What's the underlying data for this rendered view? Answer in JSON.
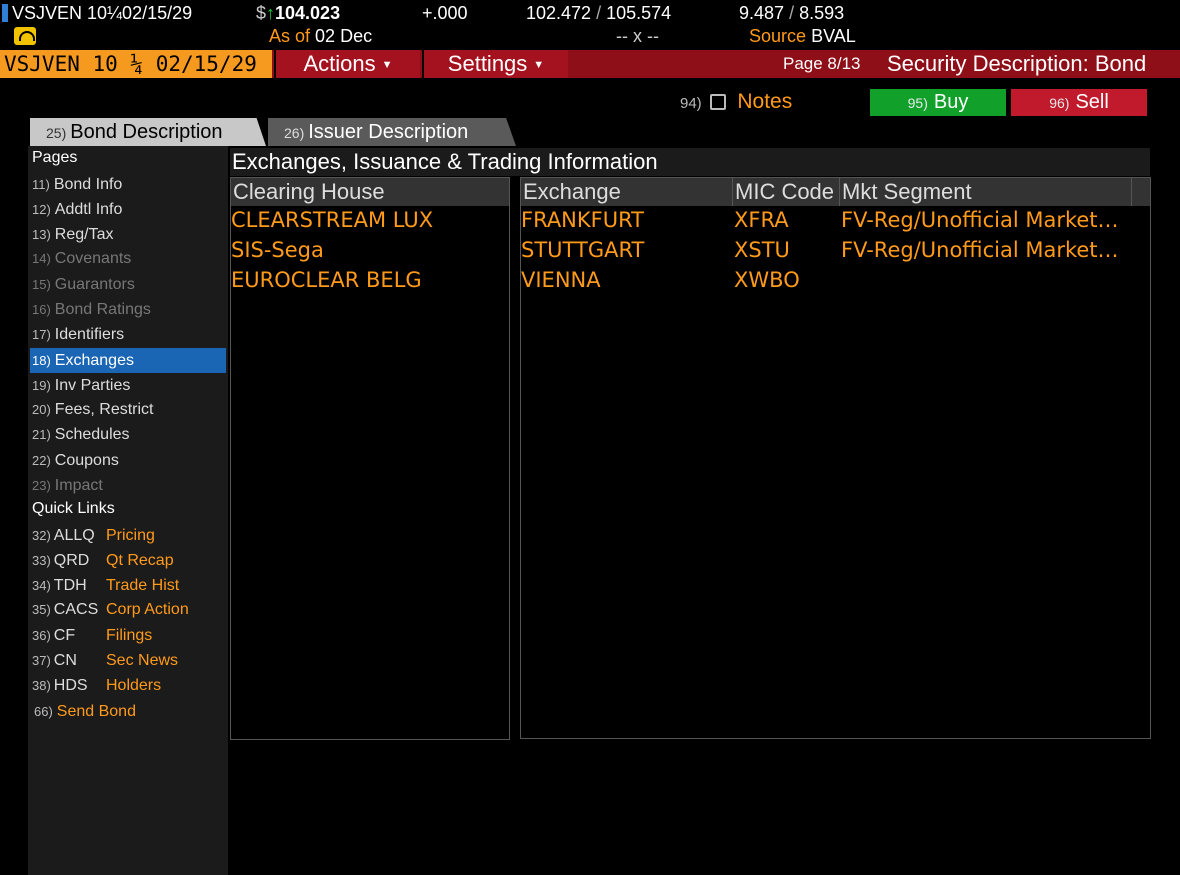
{
  "quote": {
    "ticker": "VSJVEN 10¼02/15/29",
    "currency": "$",
    "arrow": "↑",
    "price": "104.023",
    "change": "+.000",
    "bid_ask": "102.472",
    "bid_ask_sep": "/",
    "ask": "105.574",
    "yields": "9.487",
    "yields_sep": "/",
    "yield2": "8.593",
    "as_of_label": "As of",
    "as_of_date": "02 Dec",
    "spread_placeholder": "-- x --",
    "source_label": "Source",
    "source_value": "BVAL"
  },
  "function_bar": {
    "ticker": "VSJVEN 10 ¼ 02/15/29",
    "actions_label": "Actions",
    "settings_label": "Settings",
    "page_indicator": "Page 8/13",
    "screen_title": "Security Description: Bond"
  },
  "action_row": {
    "notes_num": "94)",
    "notes_label": "Notes",
    "buy_num": "95)",
    "buy_label": "Buy",
    "sell_num": "96)",
    "sell_label": "Sell"
  },
  "tabs": [
    {
      "num": "25)",
      "label": "Bond Description"
    },
    {
      "num": "26)",
      "label": "Issuer Description"
    }
  ],
  "sidebar": {
    "pages_heading": "Pages",
    "pages": [
      {
        "num": "11)",
        "label": "Bond Info",
        "state": "normal"
      },
      {
        "num": "12)",
        "label": "Addtl Info",
        "state": "normal"
      },
      {
        "num": "13)",
        "label": "Reg/Tax",
        "state": "normal"
      },
      {
        "num": "14)",
        "label": "Covenants",
        "state": "disabled"
      },
      {
        "num": "15)",
        "label": "Guarantors",
        "state": "disabled"
      },
      {
        "num": "16)",
        "label": "Bond Ratings",
        "state": "disabled"
      },
      {
        "num": "17)",
        "label": "Identifiers",
        "state": "normal"
      },
      {
        "num": "18)",
        "label": "Exchanges",
        "state": "selected"
      },
      {
        "num": "19)",
        "label": "Inv Parties",
        "state": "normal"
      },
      {
        "num": "20)",
        "label": "Fees, Restrict",
        "state": "normal"
      },
      {
        "num": "21)",
        "label": "Schedules",
        "state": "normal"
      },
      {
        "num": "22)",
        "label": "Coupons",
        "state": "normal"
      },
      {
        "num": "23)",
        "label": "Impact",
        "state": "disabled"
      }
    ],
    "quick_links_heading": "Quick Links",
    "quick_links": [
      {
        "num": "32)",
        "code": "ALLQ",
        "label": "Pricing"
      },
      {
        "num": "33)",
        "code": "QRD",
        "label": "Qt Recap"
      },
      {
        "num": "34)",
        "code": "TDH",
        "label": "Trade Hist"
      },
      {
        "num": "35)",
        "code": "CACS",
        "label": "Corp Action"
      },
      {
        "num": "36)",
        "code": "CF",
        "label": "Filings"
      },
      {
        "num": "37)",
        "code": "CN",
        "label": "Sec News"
      },
      {
        "num": "38)",
        "code": "HDS",
        "label": "Holders"
      }
    ],
    "send_num": "66)",
    "send_label": "Send Bond"
  },
  "main": {
    "section_title": "Exchanges, Issuance & Trading Information",
    "clearing": {
      "header": "Clearing House",
      "rows": [
        "CLEARSTREAM LUX",
        "SIS-Sega",
        "EUROCLEAR BELG"
      ]
    },
    "exchanges": {
      "headers": [
        "Exchange",
        "MIC Code",
        "Mkt Segment"
      ],
      "rows": [
        [
          "FRANKFURT",
          "XFRA",
          "FV-Reg/Unofficial Market…"
        ],
        [
          "STUTTGART",
          "XSTU",
          "FV-Reg/Unofficial Market…"
        ],
        [
          "VIENNA",
          "XWBO",
          ""
        ]
      ]
    }
  },
  "colors": {
    "accent_orange": "#ff9a1a",
    "function_bar_red": "#8e0f18",
    "buy_green": "#11a12b",
    "sell_red": "#c01a2c",
    "selected_blue": "#1a65b4"
  }
}
